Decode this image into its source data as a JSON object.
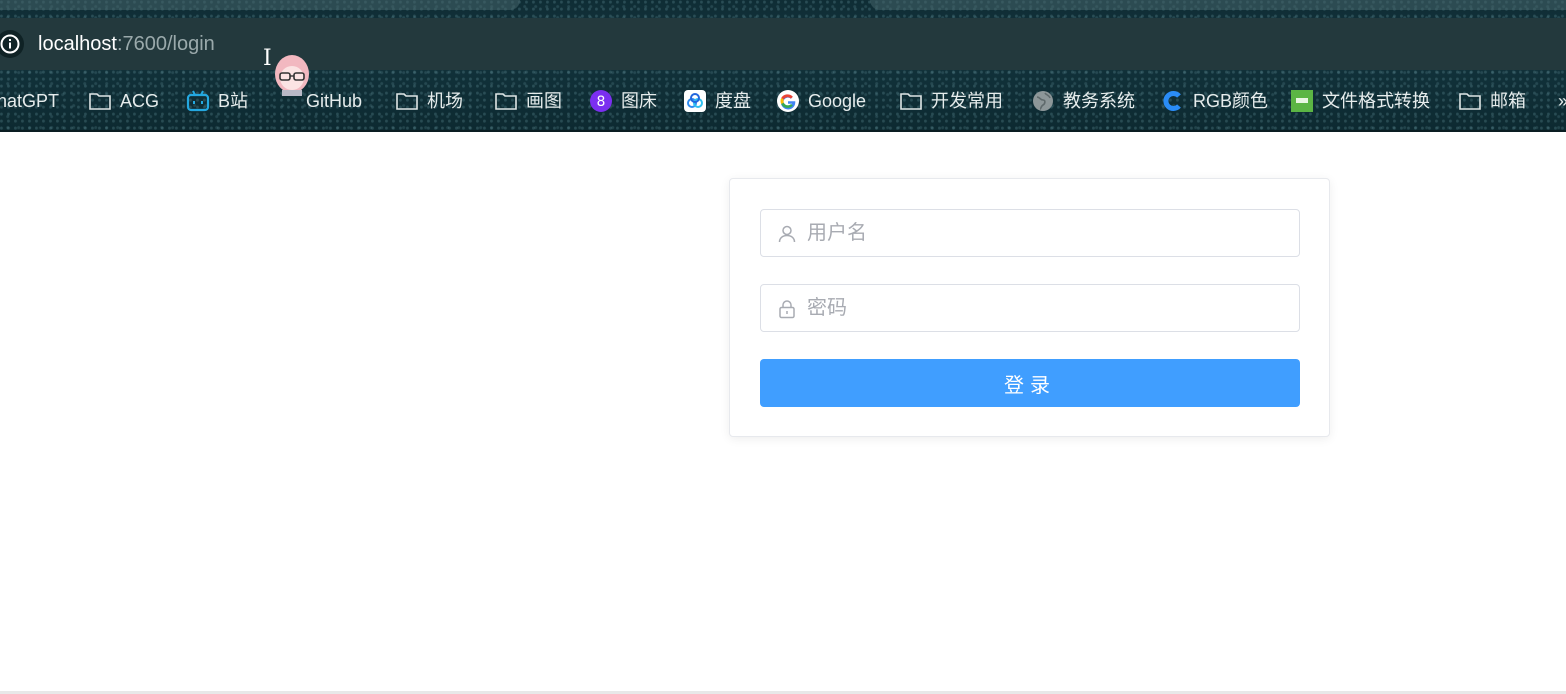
{
  "browser": {
    "url_host": "localhost",
    "url_path": ":7600/login",
    "bookmarks": [
      {
        "label": "hatGPT",
        "icon": "none"
      },
      {
        "label": "ACG",
        "icon": "folder-icon"
      },
      {
        "label": "B站",
        "icon": "bilibili-icon"
      },
      {
        "label": "GitHub",
        "icon": "github-icon"
      },
      {
        "label": "机场",
        "icon": "folder-icon"
      },
      {
        "label": "画图",
        "icon": "folder-icon"
      },
      {
        "label": "图床",
        "icon": "purple-badge-icon"
      },
      {
        "label": "度盘",
        "icon": "baidu-pan-icon"
      },
      {
        "label": "Google",
        "icon": "google-icon"
      },
      {
        "label": "开发常用",
        "icon": "folder-icon"
      },
      {
        "label": "教务系统",
        "icon": "globe-icon"
      },
      {
        "label": "RGB颜色",
        "icon": "c-logo-icon"
      },
      {
        "label": "文件格式转换",
        "icon": "green-square-icon"
      },
      {
        "label": "邮箱",
        "icon": "folder-icon"
      }
    ],
    "overflow_glyph": "»"
  },
  "login": {
    "username_placeholder": "用户名",
    "password_placeholder": "密码",
    "button_label": "登录"
  },
  "colors": {
    "primary": "#409eff",
    "chrome_bg": "#12333c",
    "address_bar": "#23393d"
  }
}
